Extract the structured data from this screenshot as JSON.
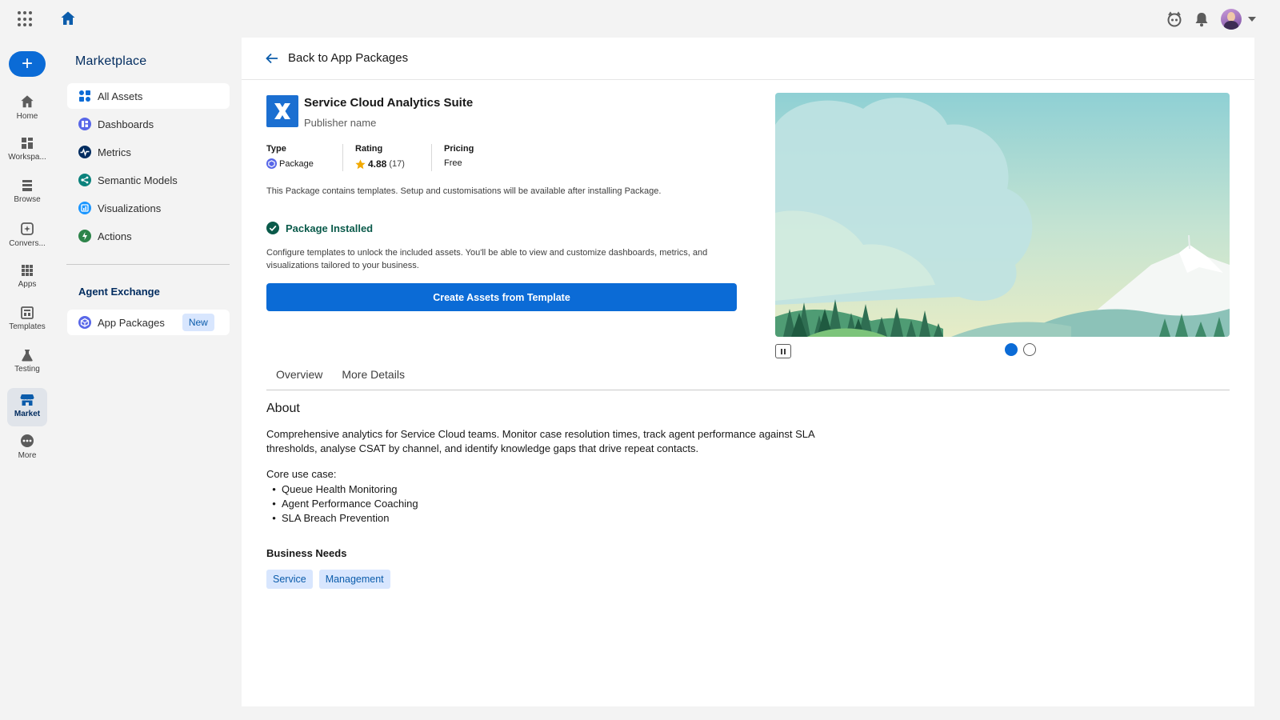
{
  "topbar": {
    "app_launcher_icon": "waffle-icon",
    "home_icon": "home-icon",
    "right_icons": [
      "agent-icon",
      "bell-icon",
      "avatar",
      "chevron-down-icon"
    ]
  },
  "rail": {
    "new_button": "+",
    "items": [
      {
        "label": "Home",
        "icon": "home-icon"
      },
      {
        "label": "Workspa...",
        "icon": "workspace-icon"
      },
      {
        "label": "Browse",
        "icon": "browse-icon"
      },
      {
        "label": "Convers...",
        "icon": "conversation-icon"
      },
      {
        "label": "Apps",
        "icon": "apps-icon"
      },
      {
        "label": "Templates",
        "icon": "templates-icon"
      },
      {
        "label": "Testing",
        "icon": "flask-icon"
      },
      {
        "label": "Market",
        "icon": "store-icon"
      },
      {
        "label": "More",
        "icon": "more-icon"
      }
    ]
  },
  "sidebar": {
    "title": "Marketplace",
    "items": [
      {
        "label": "All Assets",
        "icon": "grid-icon",
        "color": "#0b6bd6"
      },
      {
        "label": "Dashboards",
        "icon": "dashboard-icon",
        "color": "#5867e8"
      },
      {
        "label": "Metrics",
        "icon": "pulse-icon",
        "color": "#032d60"
      },
      {
        "label": "Semantic Models",
        "icon": "model-icon",
        "color": "#0b827c"
      },
      {
        "label": "Visualizations",
        "icon": "chart-icon",
        "color": "#1b96ff"
      },
      {
        "label": "Actions",
        "icon": "action-icon",
        "color": "#2e844a"
      }
    ],
    "section_title": "Agent Exchange",
    "section_items": [
      {
        "label": "App Packages",
        "icon": "package-icon",
        "badge": "New"
      }
    ]
  },
  "main": {
    "back_label": "Back to App Packages",
    "app": {
      "title": "Service Cloud Analytics Suite",
      "publisher": "Publisher name",
      "type_label": "Type",
      "type_value": "Package",
      "rating_label": "Rating",
      "rating_value": "4.88",
      "rating_count": "(17)",
      "pricing_label": "Pricing",
      "pricing_value": "Free",
      "note": "This Package contains templates. Setup and customisations will be available after installing Package."
    },
    "installed": {
      "label": "Package Installed",
      "text": "Configure templates to unlock the included assets. You'll be able to view and customize dashboards, metrics, and visualizations tailored to your business.",
      "cta": "Create Assets from Template"
    },
    "carousel": {
      "slides": 2,
      "active": 1
    },
    "tabs": [
      "Overview",
      "More Details"
    ],
    "about": {
      "heading": "About",
      "body": "Comprehensive analytics for Service Cloud teams. Monitor case resolution times, track agent performance against SLA thresholds, analyse CSAT by channel, and identify knowledge gaps that drive repeat contacts.",
      "core_heading": "Core use case:",
      "core_items": [
        "Queue Health Monitoring",
        "Agent Performance Coaching",
        "SLA Breach Prevention"
      ],
      "needs_heading": "Business Needs",
      "needs": [
        "Service",
        "Management"
      ]
    }
  },
  "colors": {
    "brand": "#0b6bd6",
    "navy": "#032d60",
    "success": "#2e844a",
    "pill_bg": "#d8e6fe"
  }
}
